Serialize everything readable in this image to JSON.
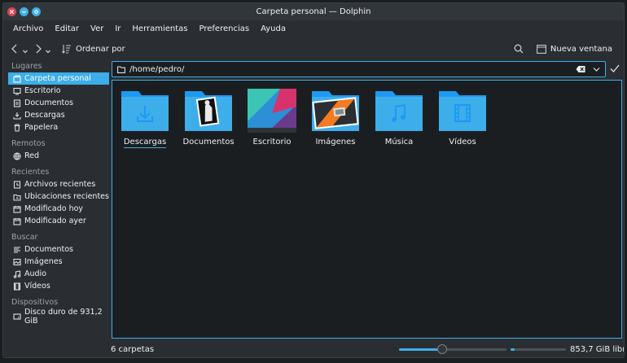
{
  "window": {
    "title": "Carpeta personal — Dolphin"
  },
  "menubar": [
    "Archivo",
    "Editar",
    "Ver",
    "Ir",
    "Herramientas",
    "Preferencias",
    "Ayuda"
  ],
  "toolbar": {
    "sort_label": "Ordenar por",
    "new_window_label": "Nueva ventana"
  },
  "sidebar": {
    "places_header": "Lugares",
    "places": [
      {
        "label": "Carpeta personal",
        "icon": "home-icon"
      },
      {
        "label": "Escritorio",
        "icon": "desktop-icon"
      },
      {
        "label": "Documentos",
        "icon": "documents-icon"
      },
      {
        "label": "Descargas",
        "icon": "download-icon"
      },
      {
        "label": "Papelera",
        "icon": "trash-icon"
      }
    ],
    "remote_header": "Remotos",
    "remote": [
      {
        "label": "Red",
        "icon": "network-icon"
      }
    ],
    "recent_header": "Recientes",
    "recent": [
      {
        "label": "Archivos recientes",
        "icon": "recent-files-icon"
      },
      {
        "label": "Ubicaciones recientes",
        "icon": "recent-places-icon"
      },
      {
        "label": "Modificado hoy",
        "icon": "calendar-icon"
      },
      {
        "label": "Modificado ayer",
        "icon": "calendar-icon"
      }
    ],
    "search_header": "Buscar",
    "search": [
      {
        "label": "Documentos",
        "icon": "documents-icon"
      },
      {
        "label": "Imágenes",
        "icon": "image-icon"
      },
      {
        "label": "Audio",
        "icon": "music-icon"
      },
      {
        "label": "Vídeos",
        "icon": "video-icon"
      }
    ],
    "devices_header": "Dispositivos",
    "devices": [
      {
        "label": "Disco duro de 931,2 GiB",
        "icon": "hard-disk-icon"
      }
    ]
  },
  "location": {
    "path": "/home/pedro/"
  },
  "folders": [
    "Descargas",
    "Documentos",
    "Escritorio",
    "Imágenes",
    "Música",
    "Vídeos"
  ],
  "status": {
    "count": "6 carpetas",
    "free_space": "853,7 GiB libre",
    "zoom_fraction": 0.4,
    "disk_used_fraction": 0.08
  },
  "colors": {
    "accent": "#3daee9",
    "folder": "#3daee9",
    "folder_dark": "#1d99f3"
  }
}
